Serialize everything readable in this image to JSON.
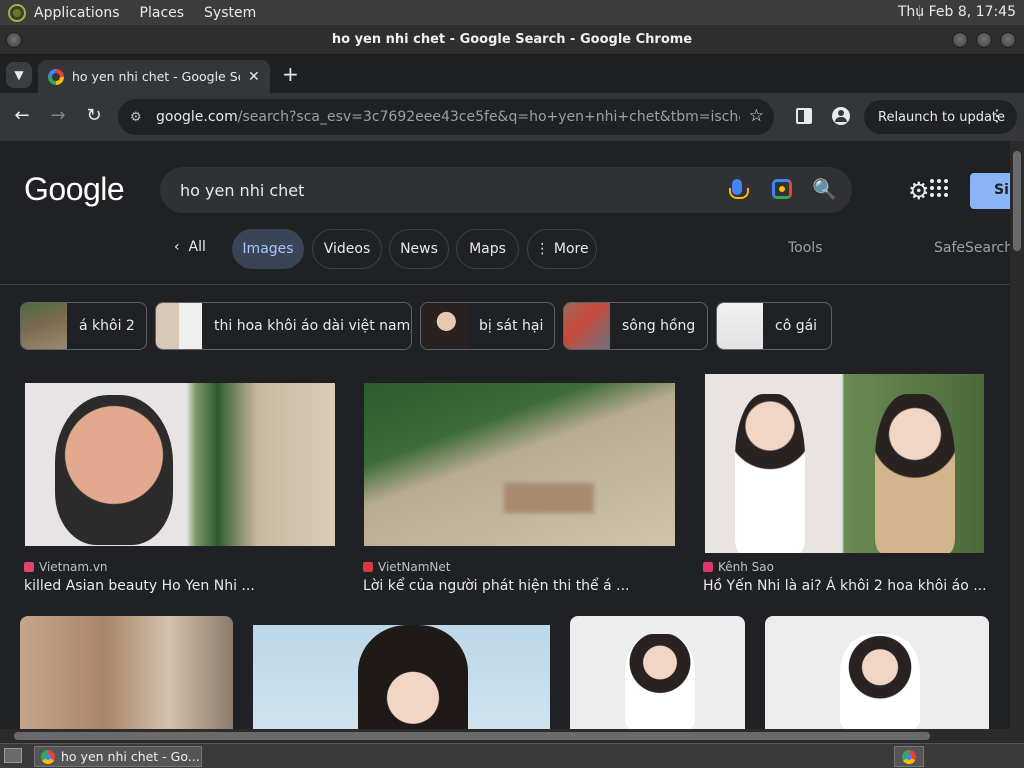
{
  "os": {
    "menus": [
      "Applications",
      "Places",
      "System"
    ],
    "clock": "Thu Feb  8, 17:45"
  },
  "window": {
    "title": "ho yen nhi chet - Google Search - Google Chrome"
  },
  "tabs": [
    {
      "title": "ho yen nhi chet - Google Sear",
      "close": "✕"
    }
  ],
  "toolbar": {
    "url_host": "google.com",
    "url_path": "/search?sca_esv=3c7692eee43ce5fe&q=ho+yen+nhi+chet&tbm=isch&source=ln...",
    "relaunch_label": "Relaunch to update",
    "new_tab": "+"
  },
  "search": {
    "logo": "Google",
    "query": "ho yen nhi chet",
    "signin_label": "Si"
  },
  "filters": {
    "back_label": "All",
    "chips": [
      "Images",
      "Videos",
      "News",
      "Maps",
      "More"
    ],
    "active": "Images",
    "tools": "Tools",
    "safesearch": "SafeSearch"
  },
  "related": [
    {
      "label": "á khôi 2"
    },
    {
      "label": "thi hoa khôi áo dài việt nam"
    },
    {
      "label": "bị sát hại"
    },
    {
      "label": "sông hồng"
    },
    {
      "label": "cô gái"
    }
  ],
  "results": [
    {
      "source": "Vietnam.vn",
      "caption": "killed Asian beauty Ho Yen Nhi ...",
      "source_color": "#e0446b"
    },
    {
      "source": "VietNamNet",
      "caption": "Lời kể của người phát hiện thi thể á ...",
      "source_color": "#d93a3a"
    },
    {
      "source": "Kênh Sao",
      "caption": "Hồ Yến Nhi là ai? Á khôi 2 hoa khôi áo ...",
      "source_color": "#e0356a"
    }
  ],
  "taskbar": {
    "item_title": "ho yen nhi chet - Go..."
  },
  "colors": {
    "accent": "#8ab4f8",
    "background": "#202124",
    "active_chip": "#394457"
  }
}
